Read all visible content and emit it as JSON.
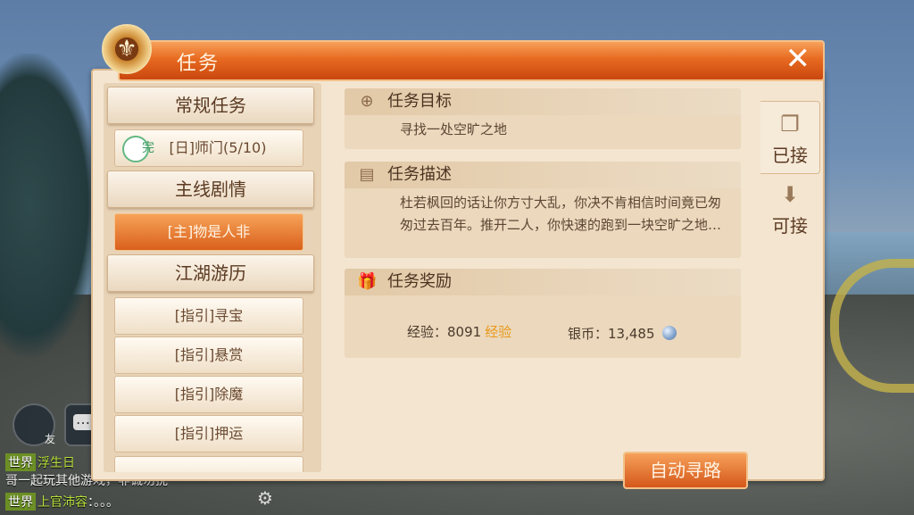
{
  "dialog": {
    "title": "任务",
    "close_glyph": "✕",
    "emblem_glyph": "⚜"
  },
  "left_list": {
    "categories": [
      {
        "label": "常规任务"
      },
      {
        "label": "主线剧情"
      },
      {
        "label": "江湖游历"
      }
    ],
    "regular_items": [
      {
        "label": "[日]师门(5/10)",
        "badge": "完"
      }
    ],
    "main_items": [
      {
        "label": "[主]物是人非"
      }
    ],
    "wander_items": [
      {
        "label": "[指引]寻宝"
      },
      {
        "label": "[指引]悬赏"
      },
      {
        "label": "[指引]除魔"
      },
      {
        "label": "[指引]押运"
      }
    ]
  },
  "detail": {
    "goal_title": "任务目标",
    "goal_text": "寻找一处空旷之地",
    "desc_title": "任务描述",
    "desc_text": "杜若枫回的话让你方寸大乱，你决不肯相信时间竟已匆匆过去百年。推开二人，你快速的跑到一块空旷之地…",
    "reward_title": "任务奖励",
    "exp_label": "经验：",
    "exp_value": "8091",
    "exp_tag": "经验",
    "silver_label": "银币：",
    "silver_value": "13,485",
    "auto_path_button": "自动寻路"
  },
  "tabs": [
    {
      "label": "已接",
      "icon": "accepted-icon"
    },
    {
      "label": "可接",
      "icon": "download-icon"
    }
  ],
  "hud": {
    "friend_label": "友",
    "chat_lines": [
      {
        "channel": "世界",
        "name": "浮生日",
        "text": ""
      },
      {
        "channel": "",
        "name": "",
        "text": "哥一起玩其他游戏，非诚勿扰"
      },
      {
        "channel": "世界",
        "name": "上官沛容",
        "text": "：。。。"
      }
    ]
  },
  "colors": {
    "accent": "#e86a21",
    "panel": "#f4e5d0",
    "reward_tag": "#e99a1b"
  }
}
